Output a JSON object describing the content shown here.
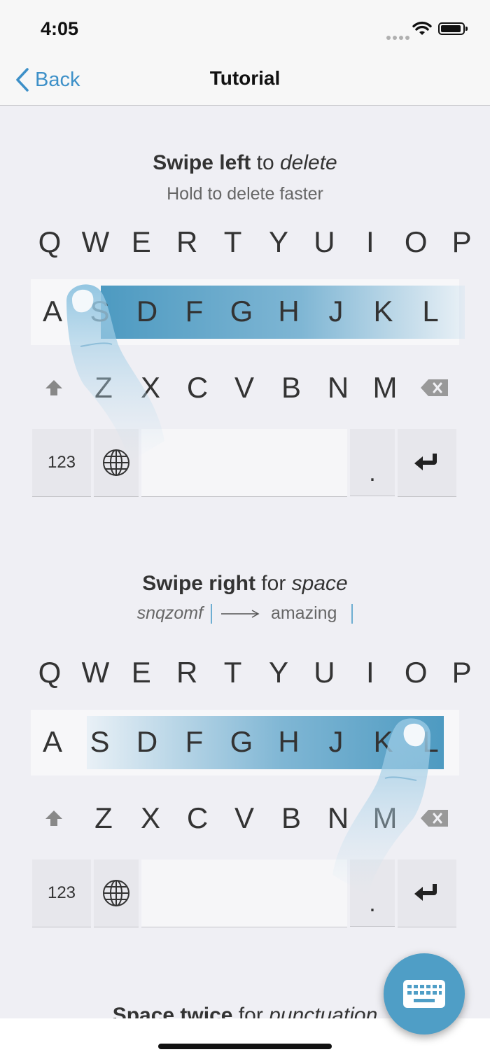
{
  "status": {
    "time": "4:05"
  },
  "nav": {
    "back_label": "Back",
    "title": "Tutorial"
  },
  "section1": {
    "title_bold": "Swipe left",
    "title_mid": " to ",
    "title_italic": "delete",
    "subtitle": "Hold to delete faster"
  },
  "section2": {
    "title_bold": "Swipe right",
    "title_mid": " for ",
    "title_italic": "space",
    "example_from": "snqzomf",
    "example_to": "amazing"
  },
  "section3": {
    "title_bold": "Space twice",
    "title_mid": " for ",
    "title_italic": "punctuation"
  },
  "keyboard": {
    "row1": [
      "Q",
      "W",
      "E",
      "R",
      "T",
      "Y",
      "U",
      "I",
      "O",
      "P"
    ],
    "row2": [
      "A",
      "S",
      "D",
      "F",
      "G",
      "H",
      "J",
      "K",
      "L"
    ],
    "row3": [
      "Z",
      "X",
      "C",
      "V",
      "B",
      "N",
      "M"
    ],
    "numbers_label": "123",
    "period_label": "."
  },
  "icons": {
    "back": "chevron-left-icon",
    "shift": "shift-icon",
    "delete": "backspace-icon",
    "globe": "globe-icon",
    "return": "return-icon",
    "keyboard": "keyboard-icon",
    "finger": "finger-icon"
  },
  "colors": {
    "accent": "#3d90c8",
    "swipe": "#4d9ac1",
    "fab": "#4f9ec6"
  }
}
